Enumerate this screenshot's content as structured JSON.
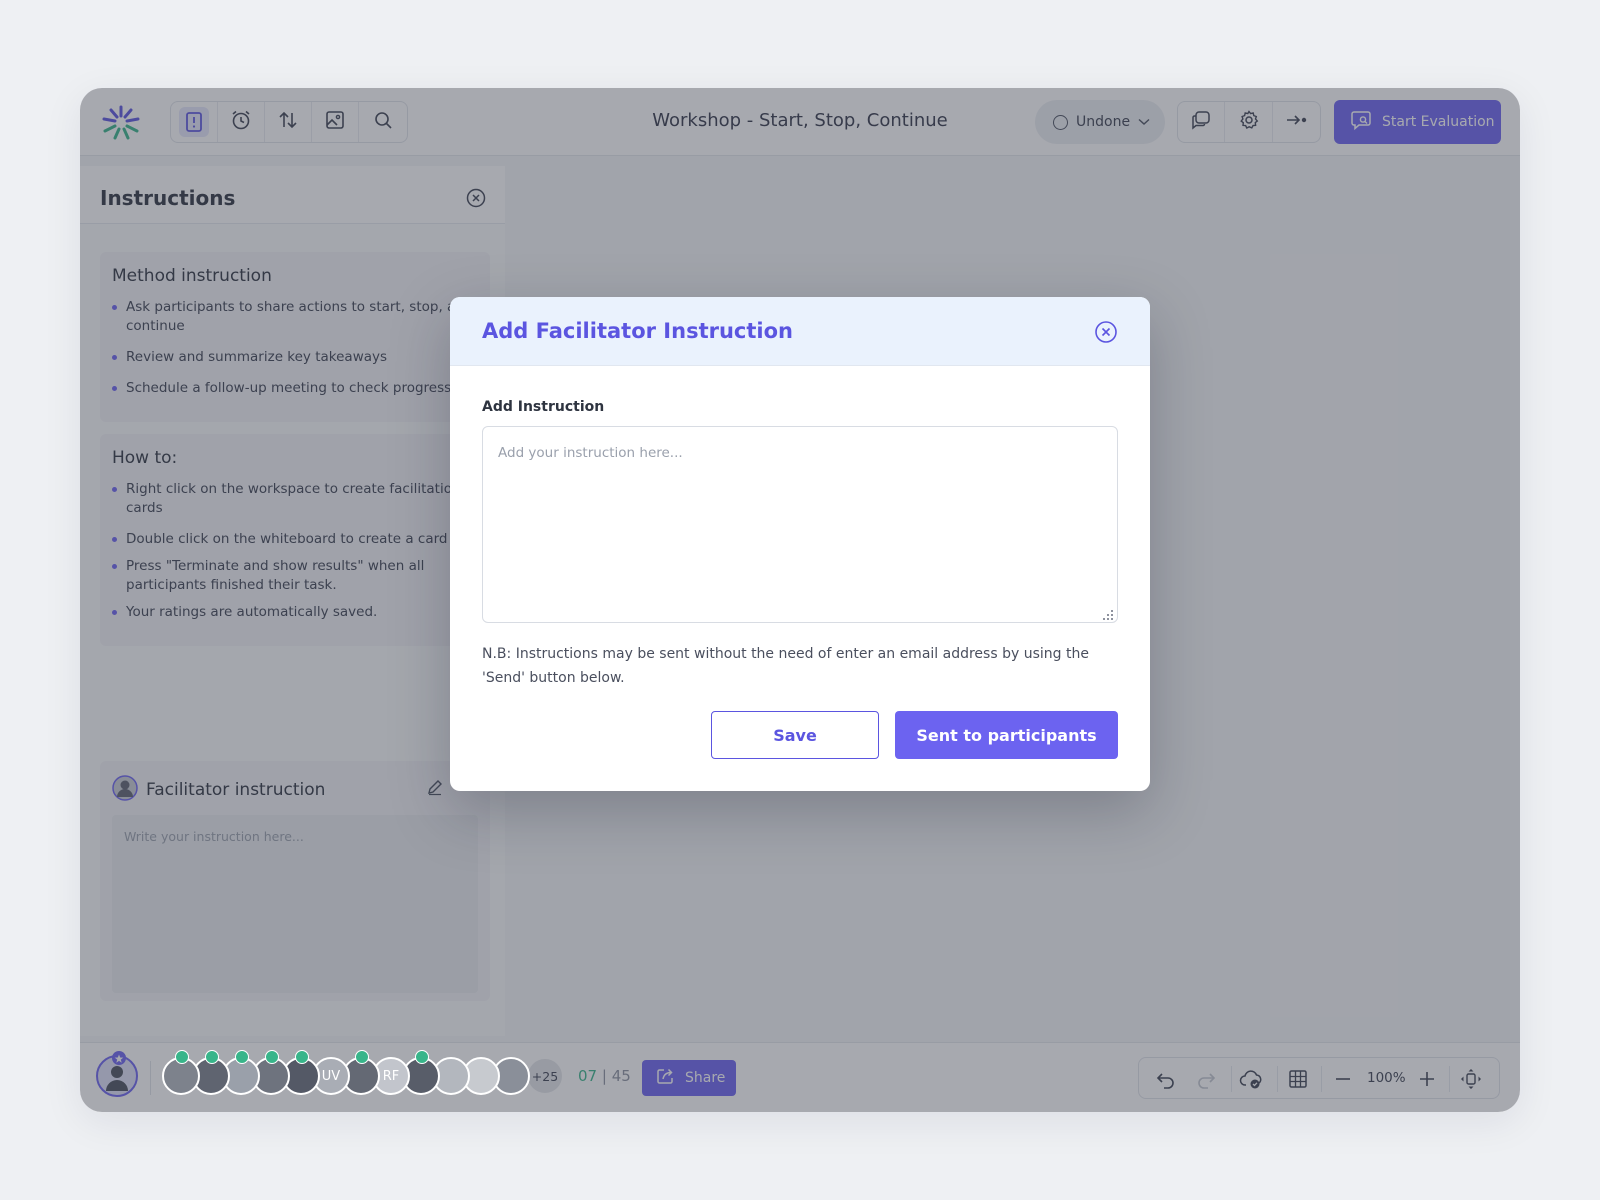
{
  "header": {
    "title": "Workshop - Start, Stop, Continue",
    "status": "Undone",
    "start_evaluation": "Start Evaluation",
    "tools": [
      "instructions-icon",
      "alarm-clock-icon",
      "sort-icon",
      "image-icon",
      "search-icon"
    ],
    "right_tools": [
      "chat-icon",
      "gear-icon",
      "exit-icon"
    ]
  },
  "panel": {
    "title": "Instructions",
    "method": {
      "title": "Method instruction",
      "items": [
        "Ask participants to share actions to start, stop, and continue",
        "Review and summarize key takeaways",
        "Schedule a follow-up meeting to check progress"
      ]
    },
    "howto": {
      "title": "How to:",
      "items": [
        "Right click on the workspace to create facilitation cards",
        "Double click on the whiteboard to create a card",
        "Press \"Terminate and show results\" when all participants finished their task.",
        "Your ratings are automatically saved."
      ]
    },
    "facilitator": {
      "title": "Facilitator instruction",
      "placeholder": "Write your instruction here..."
    }
  },
  "bottombar": {
    "avatars": [
      {
        "initials": "",
        "checked": true
      },
      {
        "initials": "",
        "checked": true
      },
      {
        "initials": "",
        "checked": true
      },
      {
        "initials": "",
        "checked": true
      },
      {
        "initials": "",
        "checked": true
      },
      {
        "initials": "UV",
        "checked": false
      },
      {
        "initials": "",
        "checked": true
      },
      {
        "initials": "RF",
        "checked": false
      },
      {
        "initials": "",
        "checked": true
      },
      {
        "initials": "",
        "checked": false
      },
      {
        "initials": "",
        "checked": false
      },
      {
        "initials": "",
        "checked": false
      }
    ],
    "more_count": "+25",
    "online": "07",
    "total": "45",
    "share": "Share",
    "zoom": "100%"
  },
  "modal": {
    "title": "Add Facilitator Instruction",
    "field_label": "Add Instruction",
    "placeholder": "Add your instruction here...",
    "note": "N.B: Instructions may be sent without the need of enter an email address by using the 'Send' button below.",
    "save": "Save",
    "send": "Sent to participants"
  },
  "colors": {
    "accent": "#6c63f0",
    "success": "#38b58a",
    "modal_header": "#eaf2fd"
  }
}
